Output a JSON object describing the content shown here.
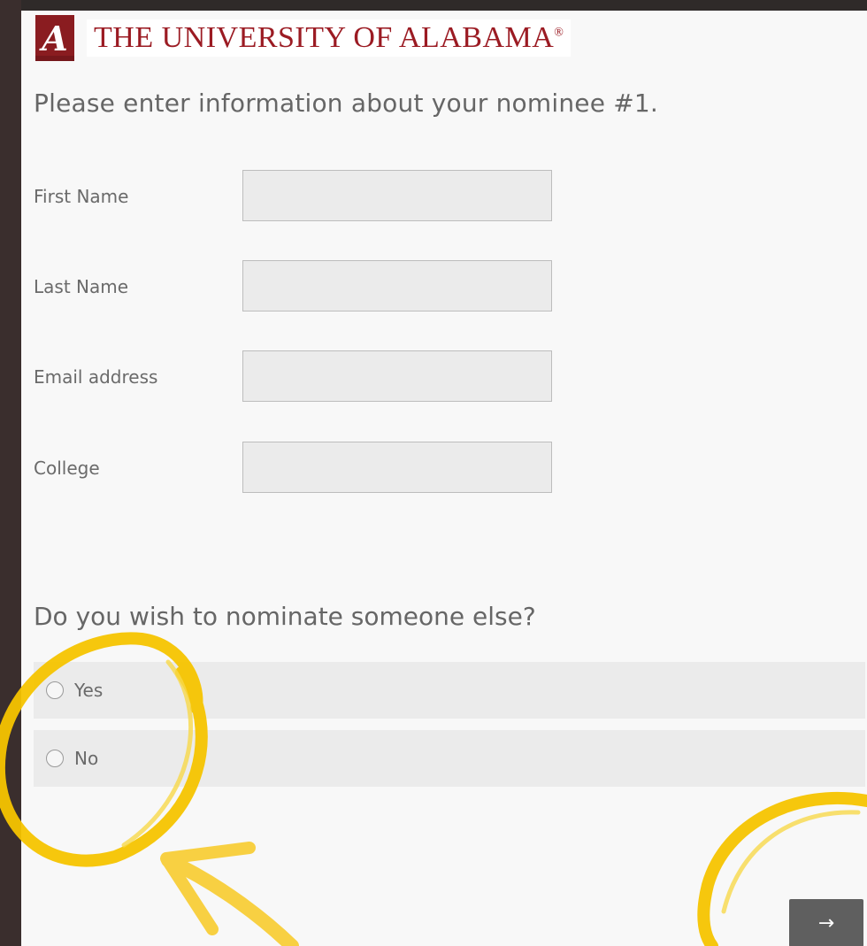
{
  "header": {
    "logo_mark": "A",
    "university_name": "THE UNIVERSITY OF ALABAMA",
    "registered_mark": "®"
  },
  "form": {
    "prompt": "Please enter information about your nominee #1.",
    "fields": [
      {
        "label": "First Name",
        "value": ""
      },
      {
        "label": "Last Name",
        "value": ""
      },
      {
        "label": "Email address",
        "value": ""
      },
      {
        "label": "College",
        "value": ""
      }
    ]
  },
  "question": {
    "text": "Do you wish to nominate someone else?",
    "options": [
      {
        "label": "Yes",
        "selected": false
      },
      {
        "label": "No",
        "selected": false
      }
    ]
  },
  "navigation": {
    "next_label": "→"
  },
  "colors": {
    "brand": "#9b1b23",
    "annotation": "#f5c400",
    "frame": "#3a2e2d",
    "button": "#5f5f5f"
  },
  "icons": {
    "next": "right-arrow-icon",
    "logo": "script-a-logo-icon"
  }
}
